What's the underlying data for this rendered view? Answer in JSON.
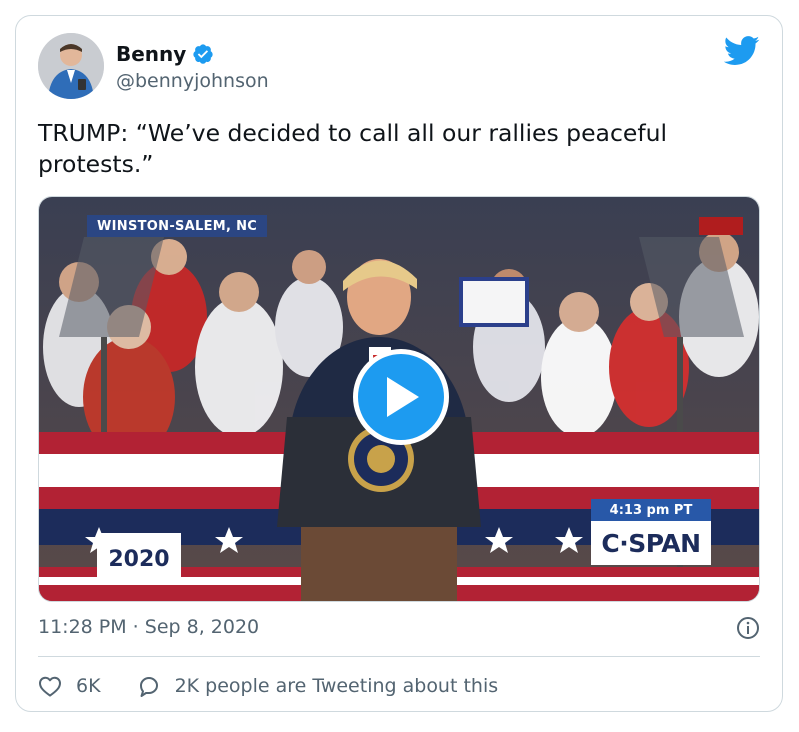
{
  "tweet": {
    "author_name": "Benny",
    "author_handle": "@bennyjohnson",
    "text": "TRUMP: “We’ve decided to call all our rallies peaceful protests.”",
    "timestamp": "11:28 PM · Sep 8, 2020",
    "likes": "6K",
    "conversation": "2K people are Tweeting about this"
  },
  "video": {
    "location_label": "WINSTON-SALEM, NC",
    "time_label": "4:13 pm PT",
    "network_logo": "C·SPAN",
    "event_logo": "2020"
  },
  "icons": {
    "verified": "verified-badge-icon",
    "twitter": "twitter-bird-icon",
    "play": "play-icon",
    "info": "info-icon",
    "like": "heart-icon",
    "reply": "speech-bubble-icon"
  },
  "colors": {
    "accent": "#1d9bf0",
    "text_primary": "#0f1419",
    "text_secondary": "#536471",
    "border": "#cfd9de"
  }
}
